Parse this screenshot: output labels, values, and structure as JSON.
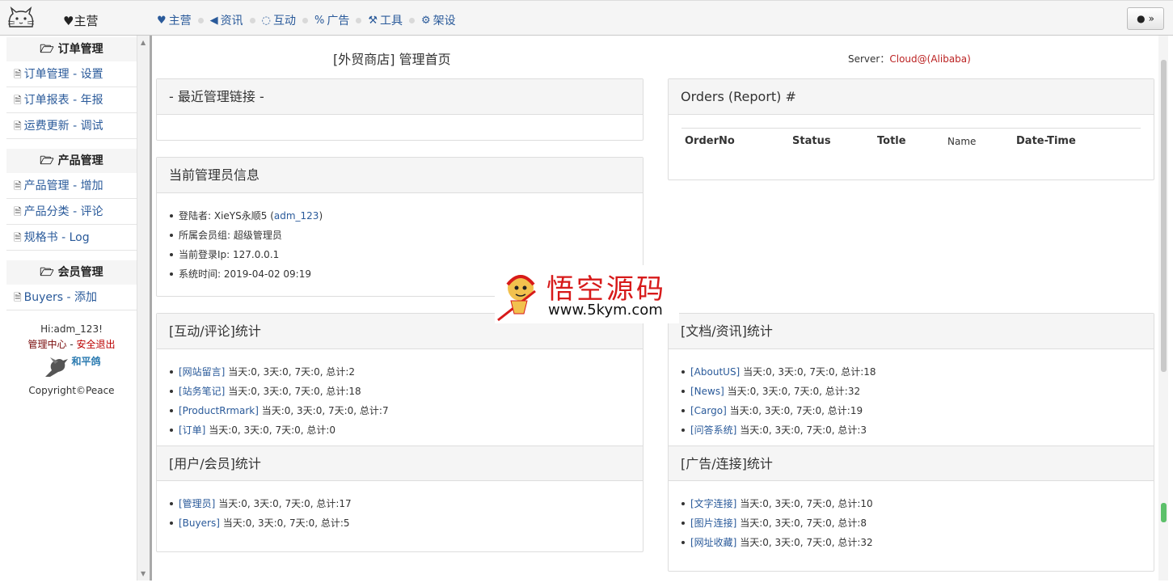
{
  "topbar": {
    "brand": "♥主营",
    "nav": [
      {
        "icon": "heart-icon",
        "glyph": "♥",
        "label": "主营"
      },
      {
        "icon": "bullhorn-icon",
        "glyph": "◀",
        "label": "资讯"
      },
      {
        "icon": "comment-icon",
        "glyph": "💬",
        "label": "互动"
      },
      {
        "icon": "link-icon",
        "glyph": "🔗",
        "label": "广告"
      },
      {
        "icon": "hammer-icon",
        "glyph": "🔨",
        "label": "工具"
      },
      {
        "icon": "cogs-icon",
        "glyph": "⚙",
        "label": "架设"
      }
    ],
    "user_button": "👤 ≫"
  },
  "sidebar": {
    "sections": [
      {
        "title": "订单管理",
        "items": [
          "订单管理 - 设置",
          "订单报表 - 年报",
          "运费更新 - 调试"
        ]
      },
      {
        "title": "产品管理",
        "items": [
          "产品管理 - 增加",
          "产品分类 - 评论",
          "规格书 - Log"
        ]
      },
      {
        "title": "会员管理",
        "items": [
          "Buyers - 添加"
        ]
      }
    ],
    "greeting": "Hi:adm_123!",
    "manage_center": "管理中心",
    "separator": " - ",
    "logout": "安全退出",
    "dove_text": "和平鸽",
    "copyright": "Copyright©Peace"
  },
  "main": {
    "page_title": "[外贸商店] 管理首页",
    "server_label": "Server：",
    "server_value": "Cloud@(Alibaba)",
    "recent_links": {
      "title": "- 最近管理链接 -"
    },
    "admin_info": {
      "title": "当前管理员信息",
      "login_label": "登陆者: XieYS永顺5 (",
      "login_user": "adm_123",
      "login_close": ")",
      "group": "所属会员组: 超级管理员",
      "ip": "当前登录Ip: 127.0.0.1",
      "time": "系统时间: 2019-04-02 09:19"
    },
    "orders": {
      "title": "Orders (Report) #",
      "columns": [
        "OrderNo",
        "Status",
        "Totle",
        "Name",
        "Date-Time"
      ]
    },
    "interaction_stats": {
      "title": "[互动/评论]统计",
      "rows": [
        {
          "tag": "[网站留言]",
          "text": " 当天:0, 3天:0, 7天:0, 总计:2"
        },
        {
          "tag": "[站务笔记]",
          "text": " 当天:0, 3天:0, 7天:0, 总计:18"
        },
        {
          "tag": "[ProductRrmark]",
          "text": " 当天:0, 3天:0, 7天:0, 总计:7"
        },
        {
          "tag": "[订单]",
          "text": " 当天:0, 3天:0, 7天:0, 总计:0"
        }
      ]
    },
    "docs_stats": {
      "title": "[文档/资讯]统计",
      "rows": [
        {
          "tag": "[AboutUS]",
          "text": " 当天:0, 3天:0, 7天:0, 总计:18"
        },
        {
          "tag": "[News]",
          "text": " 当天:0, 3天:0, 7天:0, 总计:32"
        },
        {
          "tag": "[Cargo]",
          "text": " 当天:0, 3天:0, 7天:0, 总计:19"
        },
        {
          "tag": "[问答系统]",
          "text": " 当天:0, 3天:0, 7天:0, 总计:3"
        }
      ]
    },
    "user_stats": {
      "title": "[用户/会员]统计",
      "rows": [
        {
          "tag": "[管理员]",
          "text": " 当天:0, 3天:0, 7天:0, 总计:17"
        },
        {
          "tag": "[Buyers]",
          "text": " 当天:0, 3天:0, 7天:0, 总计:5"
        }
      ]
    },
    "ad_stats": {
      "title": "[广告/连接]统计",
      "rows": [
        {
          "tag": "[文字连接]",
          "text": " 当天:0, 3天:0, 7天:0, 总计:10"
        },
        {
          "tag": "[图片连接]",
          "text": " 当天:0, 3天:0, 7天:0, 总计:8"
        },
        {
          "tag": "[网址收藏]",
          "text": " 当天:0, 3天:0, 7天:0, 总计:32"
        }
      ]
    }
  },
  "watermark": {
    "title": "悟空源码",
    "url": "www.5kym.com"
  },
  "colors": {
    "link": "#2a5a9a",
    "accent_red": "#d71a1a",
    "server_red": "#b22222"
  }
}
